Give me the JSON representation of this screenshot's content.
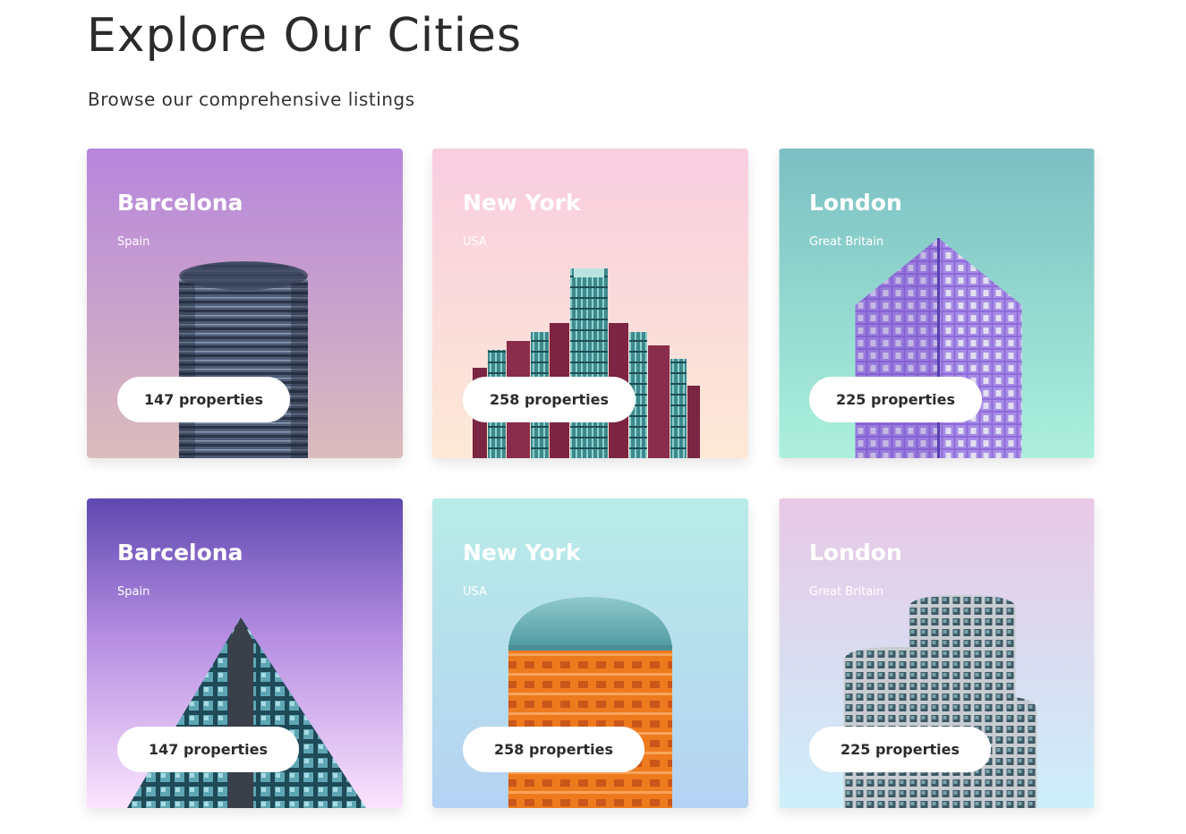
{
  "header": {
    "title": "Explore Our Cities",
    "subtitle": "Browse our comprehensive listings"
  },
  "cards": [
    {
      "city": "Barcelona",
      "country": "Spain",
      "properties": "147 properties",
      "gradient_top": "#b786dd",
      "gradient_bottom": "#dbbcbc"
    },
    {
      "city": "New York",
      "country": "USA",
      "properties": "258 properties",
      "gradient_top": "#f8cde0",
      "gradient_bottom": "#fde9d6"
    },
    {
      "city": "London",
      "country": "Great Britain",
      "properties": "225 properties",
      "gradient_top": "#7bbfc3",
      "gradient_bottom": "#acf0dc"
    },
    {
      "city": "Barcelona",
      "country": "Spain",
      "properties": "147 properties",
      "gradient_top": "#5e49b0",
      "gradient_bottom": "#fbe4fd"
    },
    {
      "city": "New York",
      "country": "USA",
      "properties": "258 properties",
      "gradient_top": "#b8ece8",
      "gradient_bottom": "#b5d2f2"
    },
    {
      "city": "London",
      "country": "Great Britain",
      "properties": "225 properties",
      "gradient_top": "#e8c8e6",
      "gradient_bottom": "#cdeffb"
    }
  ]
}
